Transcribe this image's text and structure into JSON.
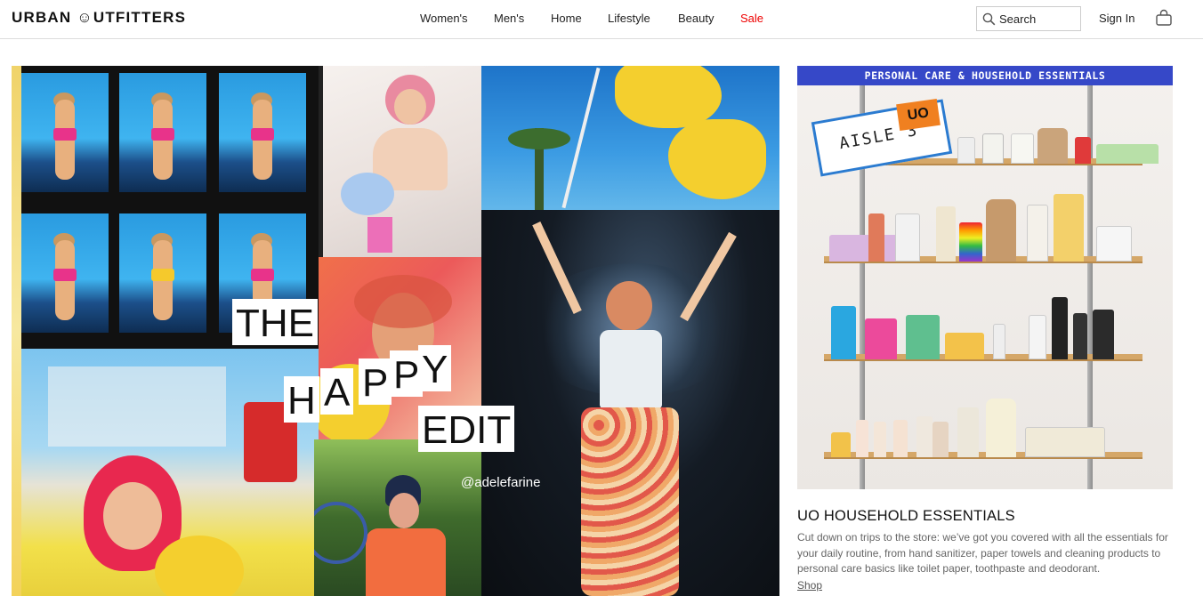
{
  "header": {
    "logo": "URBAN ☺UTFITTERS",
    "nav": [
      {
        "label": "Women's",
        "name": "nav-womens"
      },
      {
        "label": "Men's",
        "name": "nav-mens"
      },
      {
        "label": "Home",
        "name": "nav-home"
      },
      {
        "label": "Lifestyle",
        "name": "nav-lifestyle"
      },
      {
        "label": "Beauty",
        "name": "nav-beauty"
      },
      {
        "label": "Sale",
        "name": "nav-sale"
      }
    ],
    "search_placeholder": "Search",
    "sign_in": "Sign In",
    "icons": {
      "search": "search-icon",
      "bag": "shopping-bag-icon"
    },
    "sale_color": "#e00000"
  },
  "hero": {
    "title_words": [
      "THE",
      "H",
      "A",
      "P",
      "P",
      "Y",
      "EDIT"
    ],
    "handle": "@adelefarine"
  },
  "promo": {
    "band_text": "PERSONAL CARE & HOUSEHOLD ESSENTIALS",
    "sign_text": "AISLE 3",
    "badge_text": "UO",
    "title": "UO HOUSEHOLD ESSENTIALS",
    "description": "Cut down on trips to the store: we’ve got you covered with all the essentials for your daily routine, from hand sanitizer, paper towels and cleaning products to personal care basics like toilet paper, toothpaste and deodorant.",
    "link": "Shop",
    "band_color": "#3648c8"
  }
}
